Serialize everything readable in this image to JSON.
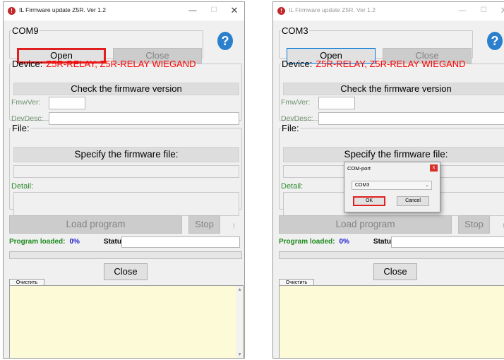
{
  "windows": [
    {
      "title": "IL Firmware update Z5R. Ver 1.2",
      "com_group": "COM9",
      "open_label": "Open",
      "close_port_label": "Close",
      "help_symbol": "?",
      "device_label": "Device:",
      "device_name": "Z5R-RELAY, Z5R-RELAY WIEGAND",
      "check_label": "Check the firmware version",
      "fmw_label": "FmwVer:",
      "devdesc_label": "DevDesc:",
      "file_label": "File:",
      "specify_label": "Specify the firmware file:",
      "detail_label": "Detail:",
      "load_label": "Load program",
      "stop_label": "Stop",
      "excl": "!",
      "program_loaded_label": "Program loaded:",
      "percent": "0%",
      "status_label": "Status:",
      "close_label": "Close",
      "clear_label": "Очистить"
    },
    {
      "title": "IL Firmware update Z5R. Ver 1.2",
      "com_group": "COM3",
      "open_label": "Open",
      "close_port_label": "Close",
      "help_symbol": "?",
      "device_label": "Device:",
      "device_name": "Z5R-RELAY, Z5R-RELAY WIEGAND",
      "check_label": "Check the firmware version",
      "fmw_label": "FmwVer:",
      "devdesc_label": "DevDesc:",
      "file_label": "File:",
      "specify_label": "Specify the firmware file:",
      "detail_label": "Detail:",
      "load_label": "Load program",
      "stop_label": "Stop",
      "excl": "!",
      "program_loaded_label": "Program loaded:",
      "percent": "0%",
      "status_label": "Status:",
      "close_label": "Close",
      "clear_label": "Очистить"
    }
  ],
  "dialog": {
    "title": "COM-port",
    "close_symbol": "x",
    "selected_port": "COM3",
    "ok_label": "OK",
    "cancel_label": "Cancel"
  },
  "progress_fraction": 0,
  "icons": [
    "app-icon",
    "minimize-icon",
    "maximize-icon",
    "close-icon",
    "help-icon",
    "chevron-down-icon"
  ],
  "colors": {
    "device_name": "#ff0000",
    "highlight_border": "#e02020",
    "program_loaded": "#1d8a1d",
    "percent": "#1a1ad0",
    "log_background": "#fdfad8",
    "help_icon": "#2c7fcc"
  }
}
